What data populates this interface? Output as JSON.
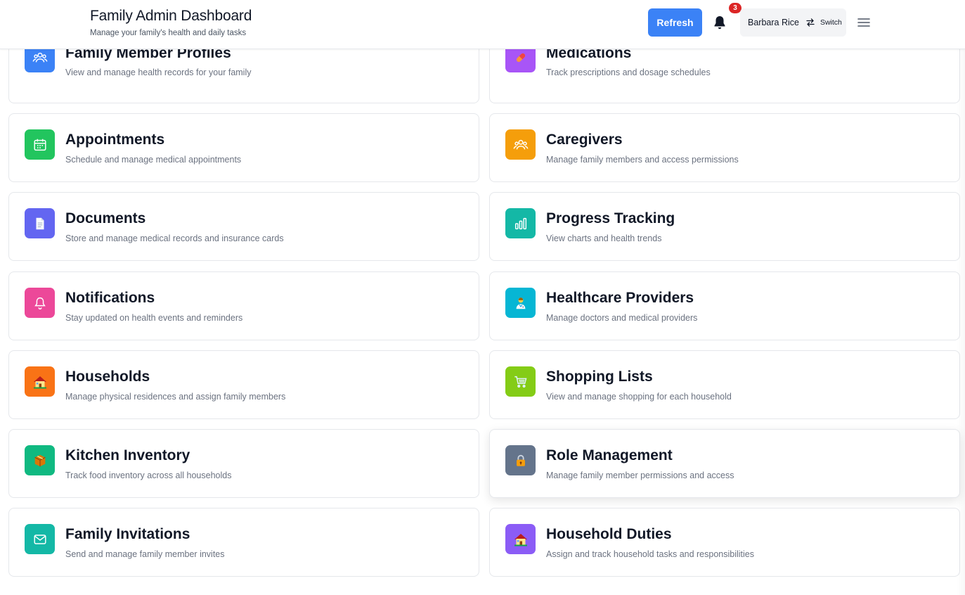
{
  "header": {
    "title": "Family Admin Dashboard",
    "subtitle": "Manage your family's health and daily tasks",
    "refresh_label": "Refresh",
    "notification_count": "3",
    "user_name": "Barbara Rice",
    "switch_label": "Switch"
  },
  "cards": [
    {
      "title": "Family Member Profiles",
      "desc": "View and manage health records for your family",
      "icon": "users-icon",
      "color": "#3b82f6"
    },
    {
      "title": "Medications",
      "desc": "Track prescriptions and dosage schedules",
      "icon": "pill-icon",
      "color": "#a855f7"
    },
    {
      "title": "Appointments",
      "desc": "Schedule and manage medical appointments",
      "icon": "calendar-icon",
      "color": "#22c55e"
    },
    {
      "title": "Caregivers",
      "desc": "Manage family members and access permissions",
      "icon": "users-icon",
      "color": "#f59e0b"
    },
    {
      "title": "Documents",
      "desc": "Store and manage medical records and insurance cards",
      "icon": "document-icon",
      "color": "#6366f1"
    },
    {
      "title": "Progress Tracking",
      "desc": "View charts and health trends",
      "icon": "bar-chart-icon",
      "color": "#14b8a6"
    },
    {
      "title": "Notifications",
      "desc": "Stay updated on health events and reminders",
      "icon": "bell-icon",
      "color": "#ec4899"
    },
    {
      "title": "Healthcare Providers",
      "desc": "Manage doctors and medical providers",
      "icon": "doctor-icon",
      "color": "#06b6d4"
    },
    {
      "title": "Households",
      "desc": "Manage physical residences and assign family members",
      "icon": "house-icon",
      "color": "#f97316"
    },
    {
      "title": "Shopping Lists",
      "desc": "View and manage shopping for each household",
      "icon": "cart-icon",
      "color": "#84cc16"
    },
    {
      "title": "Kitchen Inventory",
      "desc": "Track food inventory across all households",
      "icon": "package-icon",
      "color": "#10b981"
    },
    {
      "title": "Role Management",
      "desc": "Manage family member permissions and access",
      "icon": "lock-icon",
      "color": "#64748b"
    },
    {
      "title": "Family Invitations",
      "desc": "Send and manage family member invites",
      "icon": "mail-icon",
      "color": "#14b8a6"
    },
    {
      "title": "Household Duties",
      "desc": "Assign and track household tasks and responsibilities",
      "icon": "house-icon",
      "color": "#8b5cf6"
    }
  ]
}
